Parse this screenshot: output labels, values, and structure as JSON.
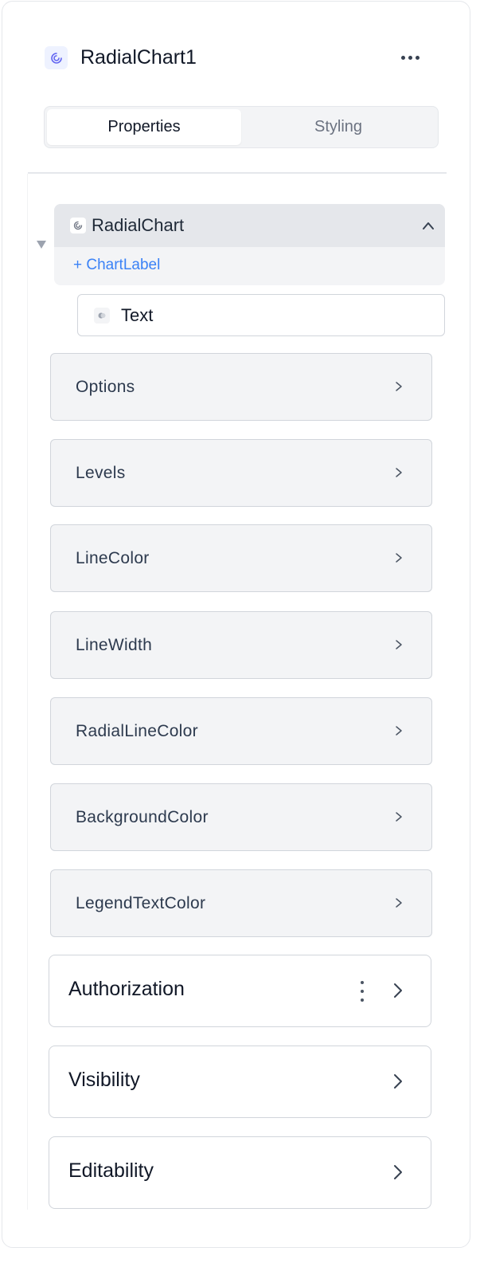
{
  "header": {
    "component_name": "RadialChart1",
    "icon": "radial-chart-icon",
    "more_icon": "more-horizontal-icon"
  },
  "tabs": [
    {
      "label": "Properties",
      "active": true
    },
    {
      "label": "Styling",
      "active": false
    }
  ],
  "tree": {
    "node_label": "RadialChart",
    "node_icon": "radial-chart-icon",
    "expanded": true,
    "add_child_label": "+ ChartLabel",
    "child": {
      "label": "Text",
      "icon": "text-component-icon"
    }
  },
  "properties": [
    {
      "label": "Options"
    },
    {
      "label": "Levels"
    },
    {
      "label": "LineColor"
    },
    {
      "label": "LineWidth"
    },
    {
      "label": "RadialLineColor"
    },
    {
      "label": "BackgroundColor"
    },
    {
      "label": "LegendTextColor"
    }
  ],
  "sections": [
    {
      "label": "Authorization",
      "has_menu": true
    },
    {
      "label": "Visibility",
      "has_menu": false
    },
    {
      "label": "Editability",
      "has_menu": false
    }
  ],
  "colors": {
    "accent": "#3b82f6",
    "panel_bg": "#f3f4f6",
    "border": "#d1d5db"
  }
}
